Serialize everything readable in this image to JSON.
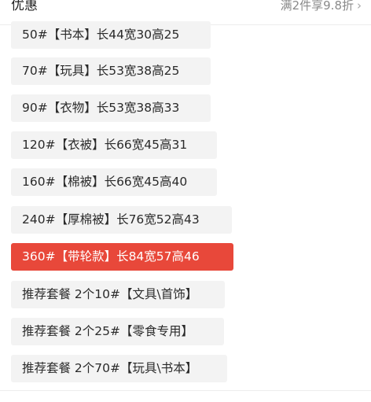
{
  "header": {
    "title": "优惠",
    "discount": "满2件享9.8折",
    "chevron": "›"
  },
  "options": [
    {
      "label": "50#【书本】长44宽30高25",
      "selected": false
    },
    {
      "label": "70#【玩具】长53宽38高25",
      "selected": false
    },
    {
      "label": "90#【衣物】长53宽38高33",
      "selected": false
    },
    {
      "label": "120#【衣被】长66宽45高31",
      "selected": false
    },
    {
      "label": "160#【棉被】长66宽45高40",
      "selected": false
    },
    {
      "label": "240#【厚棉被】长76宽52高43",
      "selected": false
    },
    {
      "label": "360#【带轮款】长84宽57高46",
      "selected": true
    },
    {
      "label": "推荐套餐 2个10#【文具\\首饰】",
      "selected": false
    },
    {
      "label": "推荐套餐 2个25#【零食专用】",
      "selected": false
    },
    {
      "label": "推荐套餐 2个70#【玩具\\书本】",
      "selected": false
    }
  ],
  "colors": {
    "accent": "#e8483a",
    "option_bg": "#f3f3f3"
  }
}
